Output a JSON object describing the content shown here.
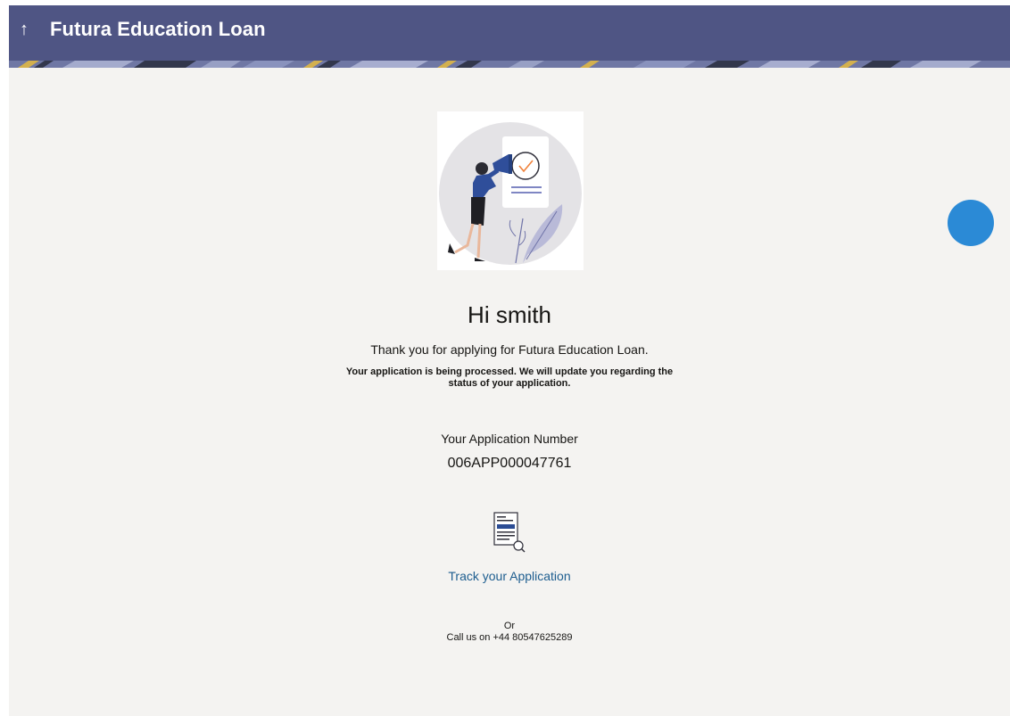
{
  "header": {
    "back_icon": "arrow-up-icon",
    "back_glyph": "↑",
    "title": "Futura Education Loan"
  },
  "confirmation": {
    "greeting": "Hi smith",
    "thank_you": "Thank you for applying for Futura Education Loan.",
    "processing_line1": "Your application is being processed. We will update you regarding the",
    "processing_line2": "status of your application.",
    "app_number_label": "Your Application Number",
    "app_number": "006APP000047761"
  },
  "track": {
    "icon": "document-search-icon",
    "label": "Track your Application"
  },
  "contact": {
    "or": "Or",
    "call": "Call us on +44 80547625289"
  },
  "colors": {
    "header": "#4f5584",
    "background": "#f4f3f1",
    "link": "#1d5d8f",
    "fab": "#2b8ad6",
    "accent_orange": "#f0823b"
  }
}
